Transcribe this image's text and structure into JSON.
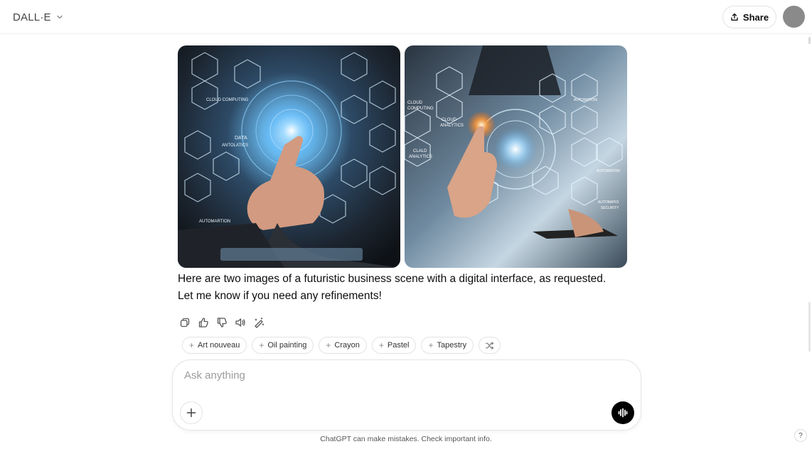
{
  "header": {
    "model_name": "DALL·E",
    "share_label": "Share"
  },
  "images": [
    {
      "alt": "Futuristic business scene image 1"
    },
    {
      "alt": "Futuristic business scene image 2"
    }
  ],
  "message": {
    "text": "Here are two images of a futuristic business scene with a digital interface, as requested. Let me know if you need any refinements!"
  },
  "style_chips": [
    {
      "label": "Art nouveau"
    },
    {
      "label": "Oil painting"
    },
    {
      "label": "Crayon"
    },
    {
      "label": "Pastel"
    },
    {
      "label": "Tapestry"
    }
  ],
  "composer": {
    "placeholder": "Ask anything"
  },
  "footer": {
    "disclaimer": "ChatGPT can make mistakes. Check important info.",
    "help_label": "?"
  },
  "colors": {
    "avatar": "#8a8a8a",
    "voice_button": "#000000"
  }
}
